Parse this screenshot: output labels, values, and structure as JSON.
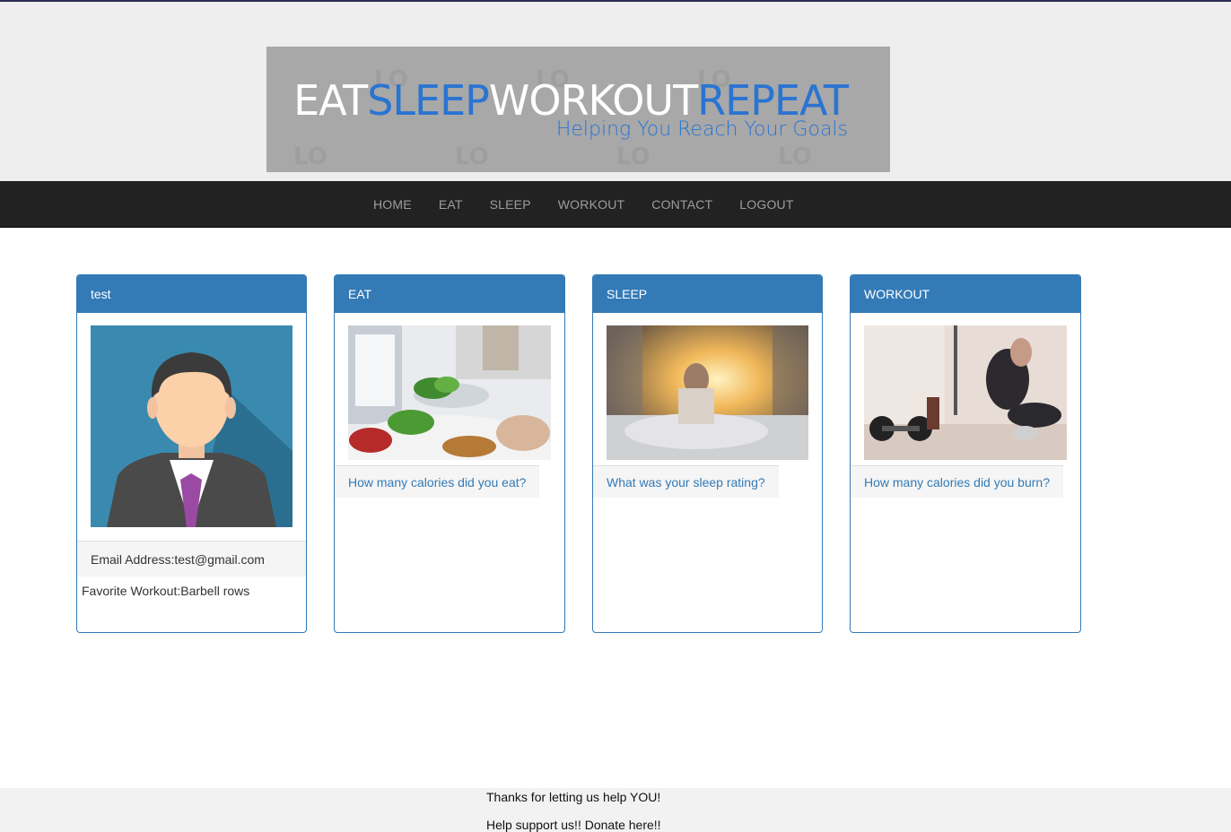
{
  "banner": {
    "title_parts": [
      "EAT",
      "SLEEP",
      "WORKOUT",
      "REPEAT"
    ],
    "tagline": "Helping You Reach Your Goals"
  },
  "nav": {
    "items": [
      "HOME",
      "EAT",
      "SLEEP",
      "WORKOUT",
      "CONTACT",
      "LOGOUT"
    ]
  },
  "profile": {
    "heading": "test",
    "email_label": "Email Address:",
    "email": "test@gmail.com",
    "workout_label": "Favorite Workout:",
    "workout": "Barbell rows"
  },
  "cards": [
    {
      "heading": "EAT",
      "link": "How many calories did you eat?"
    },
    {
      "heading": "SLEEP",
      "link": "What was your sleep rating?"
    },
    {
      "heading": "WORKOUT",
      "link": "How many calories did you burn?"
    }
  ],
  "footer": {
    "thanks": "Thanks for letting us help YOU!",
    "donate": "Help support us!! Donate here!!"
  },
  "colors": {
    "primary": "#337ab7",
    "navbar": "#222222",
    "banner_bg": "#a8a8a8",
    "banner_blue": "#2a74d2"
  }
}
